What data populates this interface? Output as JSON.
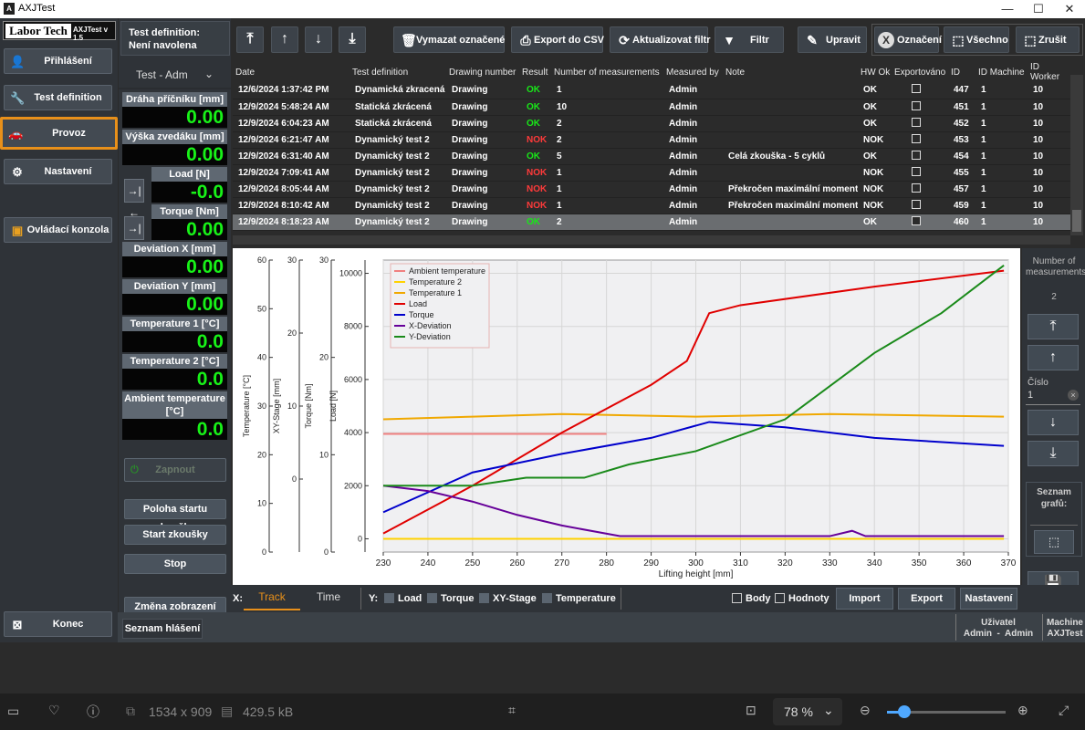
{
  "window": {
    "title": "AXJTest",
    "min": "—",
    "max": "☐",
    "close": "✕"
  },
  "logo": {
    "brand": "Labor Tech",
    "version": "AXJTest v 1.5"
  },
  "nav": {
    "items": [
      {
        "label": "Přihlášení",
        "icon": "user-icon"
      },
      {
        "label": "Test definition",
        "icon": "wrench-icon"
      },
      {
        "label": "Provoz",
        "icon": "car-icon"
      },
      {
        "label": "Nastavení",
        "icon": "gear-icon"
      },
      {
        "label": "Ovládací konzola",
        "icon": "console-icon"
      }
    ],
    "exit": "Konec"
  },
  "testdef": {
    "label": "Test definition:",
    "value": "Není navolena",
    "selector": "Test - Adm"
  },
  "readouts": [
    {
      "label": "Dráha příčníku [mm]",
      "value": "0.00"
    },
    {
      "label": "Výška zvedáku [mm]",
      "value": "0.00"
    },
    {
      "label": "Load [N]",
      "value": "-0.0"
    },
    {
      "label": "Torque [Nm]",
      "value": "0.00"
    },
    {
      "label": "Deviation X [mm]",
      "value": "0.00"
    },
    {
      "label": "Deviation Y [mm]",
      "value": "0.00"
    },
    {
      "label": "Temperature 1 [°C]",
      "value": "0.0"
    },
    {
      "label": "Temperature 2 [°C]",
      "value": "0.0"
    },
    {
      "label": "Ambient temperature [°C]",
      "value": "0.0"
    }
  ],
  "actions": {
    "zapnout": "Zapnout",
    "start_pos": "Poloha startu zkoušky",
    "start": "Start zkoušky",
    "stop": "Stop",
    "change_view": "Změna zobrazení",
    "reports": "Seznam hlášení"
  },
  "toolbar": {
    "delete": "Vymazat označené",
    "export_csv": "Export do CSV",
    "refresh": "Aktualizovat filtr",
    "filter": "Filtr",
    "edit": "Upravit",
    "marking": "Označení",
    "all": "Všechno",
    "cancel": "Zrušit"
  },
  "table": {
    "columns": [
      "Date",
      "Test definition",
      "Drawing number",
      "Result",
      "Number of measurements",
      "Measured by",
      "Note",
      "HW Ok",
      "Exportováno",
      "ID",
      "ID Machine",
      "ID Worker"
    ],
    "rows": [
      [
        "12/6/2024 1:37:42 PM",
        "Dynamická zkracená",
        "Drawing",
        "OK",
        "1",
        "Admin",
        "",
        "OK",
        "",
        "447",
        "1",
        "10"
      ],
      [
        "12/9/2024 5:48:24 AM",
        "Statická zkrácená",
        "Drawing",
        "OK",
        "10",
        "Admin",
        "",
        "OK",
        "",
        "451",
        "1",
        "10"
      ],
      [
        "12/9/2024 6:04:23 AM",
        "Statická zkrácená",
        "Drawing",
        "OK",
        "2",
        "Admin",
        "",
        "OK",
        "",
        "452",
        "1",
        "10"
      ],
      [
        "12/9/2024 6:21:47 AM",
        "Dynamický test 2",
        "Drawing",
        "NOK",
        "2",
        "Admin",
        "",
        "NOK",
        "",
        "453",
        "1",
        "10"
      ],
      [
        "12/9/2024 6:31:40 AM",
        "Dynamický test 2",
        "Drawing",
        "OK",
        "5",
        "Admin",
        "Celá zkouška - 5 cyklů",
        "OK",
        "",
        "454",
        "1",
        "10"
      ],
      [
        "12/9/2024 7:09:41 AM",
        "Dynamický test 2",
        "Drawing",
        "NOK",
        "1",
        "Admin",
        "",
        "NOK",
        "",
        "455",
        "1",
        "10"
      ],
      [
        "12/9/2024 8:05:44 AM",
        "Dynamický test 2",
        "Drawing",
        "NOK",
        "1",
        "Admin",
        "Překročen maximální moment",
        "NOK",
        "",
        "457",
        "1",
        "10"
      ],
      [
        "12/9/2024 8:10:42 AM",
        "Dynamický test 2",
        "Drawing",
        "NOK",
        "1",
        "Admin",
        "Překročen maximální moment",
        "NOK",
        "",
        "459",
        "1",
        "10"
      ],
      [
        "12/9/2024 8:18:23 AM",
        "Dynamický test 2",
        "Drawing",
        "OK",
        "2",
        "Admin",
        "",
        "OK",
        "",
        "460",
        "1",
        "10"
      ]
    ],
    "selected_row": 8
  },
  "right_panel": {
    "count_label": "Number of measurements",
    "count_value": "2",
    "cislo_label": "Číslo",
    "cislo_value": "1",
    "graphs_label": "Seznam grafů:"
  },
  "bottom": {
    "x_label": "X:",
    "tab_track": "Track",
    "tab_time": "Time",
    "y_label": "Y:",
    "y_load": "Load",
    "y_torque": "Torque",
    "y_xy": "XY-Stage",
    "y_temp": "Temperature",
    "body": "Body",
    "hodnoty": "Hodnoty",
    "import": "Import",
    "export": "Export",
    "settings": "Nastavení"
  },
  "status": {
    "user_label": "Uživatel",
    "user_value": "Admin  -  Admin",
    "machine_label": "Machine",
    "machine_value": "AXJTest"
  },
  "viewer": {
    "dims": "1534 x 909",
    "size": "429.5 kB",
    "zoom": "78 %"
  },
  "chart_data": {
    "type": "line",
    "xlabel": "Lifting height [mm]",
    "xlim": [
      230,
      370
    ],
    "xticks": [
      230,
      240,
      250,
      260,
      270,
      280,
      290,
      300,
      310,
      320,
      330,
      340,
      350,
      360,
      370
    ],
    "axes": [
      {
        "label": "Temperature [°C]",
        "lim": [
          0,
          60
        ],
        "ticks": [
          0,
          10,
          20,
          30,
          40,
          50,
          60
        ]
      },
      {
        "label": "XY-Stage [mm]",
        "lim": [
          -10,
          30
        ],
        "ticks": [
          0,
          10,
          20,
          30
        ]
      },
      {
        "label": "Torque [Nm]",
        "lim": [
          0,
          30
        ],
        "ticks": [
          0,
          10,
          20,
          30
        ]
      },
      {
        "label": "Load [N]",
        "lim": [
          -500,
          10500
        ],
        "ticks": [
          0,
          2000,
          4000,
          6000,
          8000,
          10000
        ]
      }
    ],
    "series": [
      {
        "name": "Ambient temperature",
        "color": "#f08080",
        "x": [
          230,
          280
        ],
        "y": [
          3950,
          3950
        ]
      },
      {
        "name": "Temperature 2",
        "color": "#ffd200",
        "x": [
          230,
          369
        ],
        "y": [
          0,
          0
        ]
      },
      {
        "name": "Temperature 1",
        "color": "#f0a800",
        "x": [
          230,
          250,
          270,
          300,
          330,
          369
        ],
        "y": [
          4500,
          4600,
          4700,
          4600,
          4700,
          4600
        ]
      },
      {
        "name": "Load",
        "color": "#e00000",
        "x": [
          230,
          250,
          270,
          290,
          298,
          303,
          310,
          340,
          369
        ],
        "y": [
          200,
          2000,
          4000,
          5800,
          6700,
          8500,
          8800,
          9500,
          10100
        ]
      },
      {
        "name": "Torque",
        "color": "#0000cc",
        "x": [
          230,
          250,
          270,
          290,
          303,
          320,
          340,
          369
        ],
        "y": [
          1000,
          2500,
          3200,
          3800,
          4400,
          4200,
          3800,
          3500
        ]
      },
      {
        "name": "X-Deviation",
        "color": "#660099",
        "x": [
          230,
          240,
          250,
          260,
          270,
          283,
          330,
          335,
          338,
          369
        ],
        "y": [
          2000,
          1800,
          1400,
          900,
          500,
          100,
          100,
          300,
          100,
          100
        ]
      },
      {
        "name": "Y-Deviation",
        "color": "#1a8a1a",
        "x": [
          230,
          250,
          262,
          275,
          285,
          300,
          320,
          340,
          355,
          369
        ],
        "y": [
          2000,
          2000,
          2300,
          2300,
          2800,
          3300,
          4500,
          7000,
          8500,
          10300
        ]
      }
    ]
  }
}
